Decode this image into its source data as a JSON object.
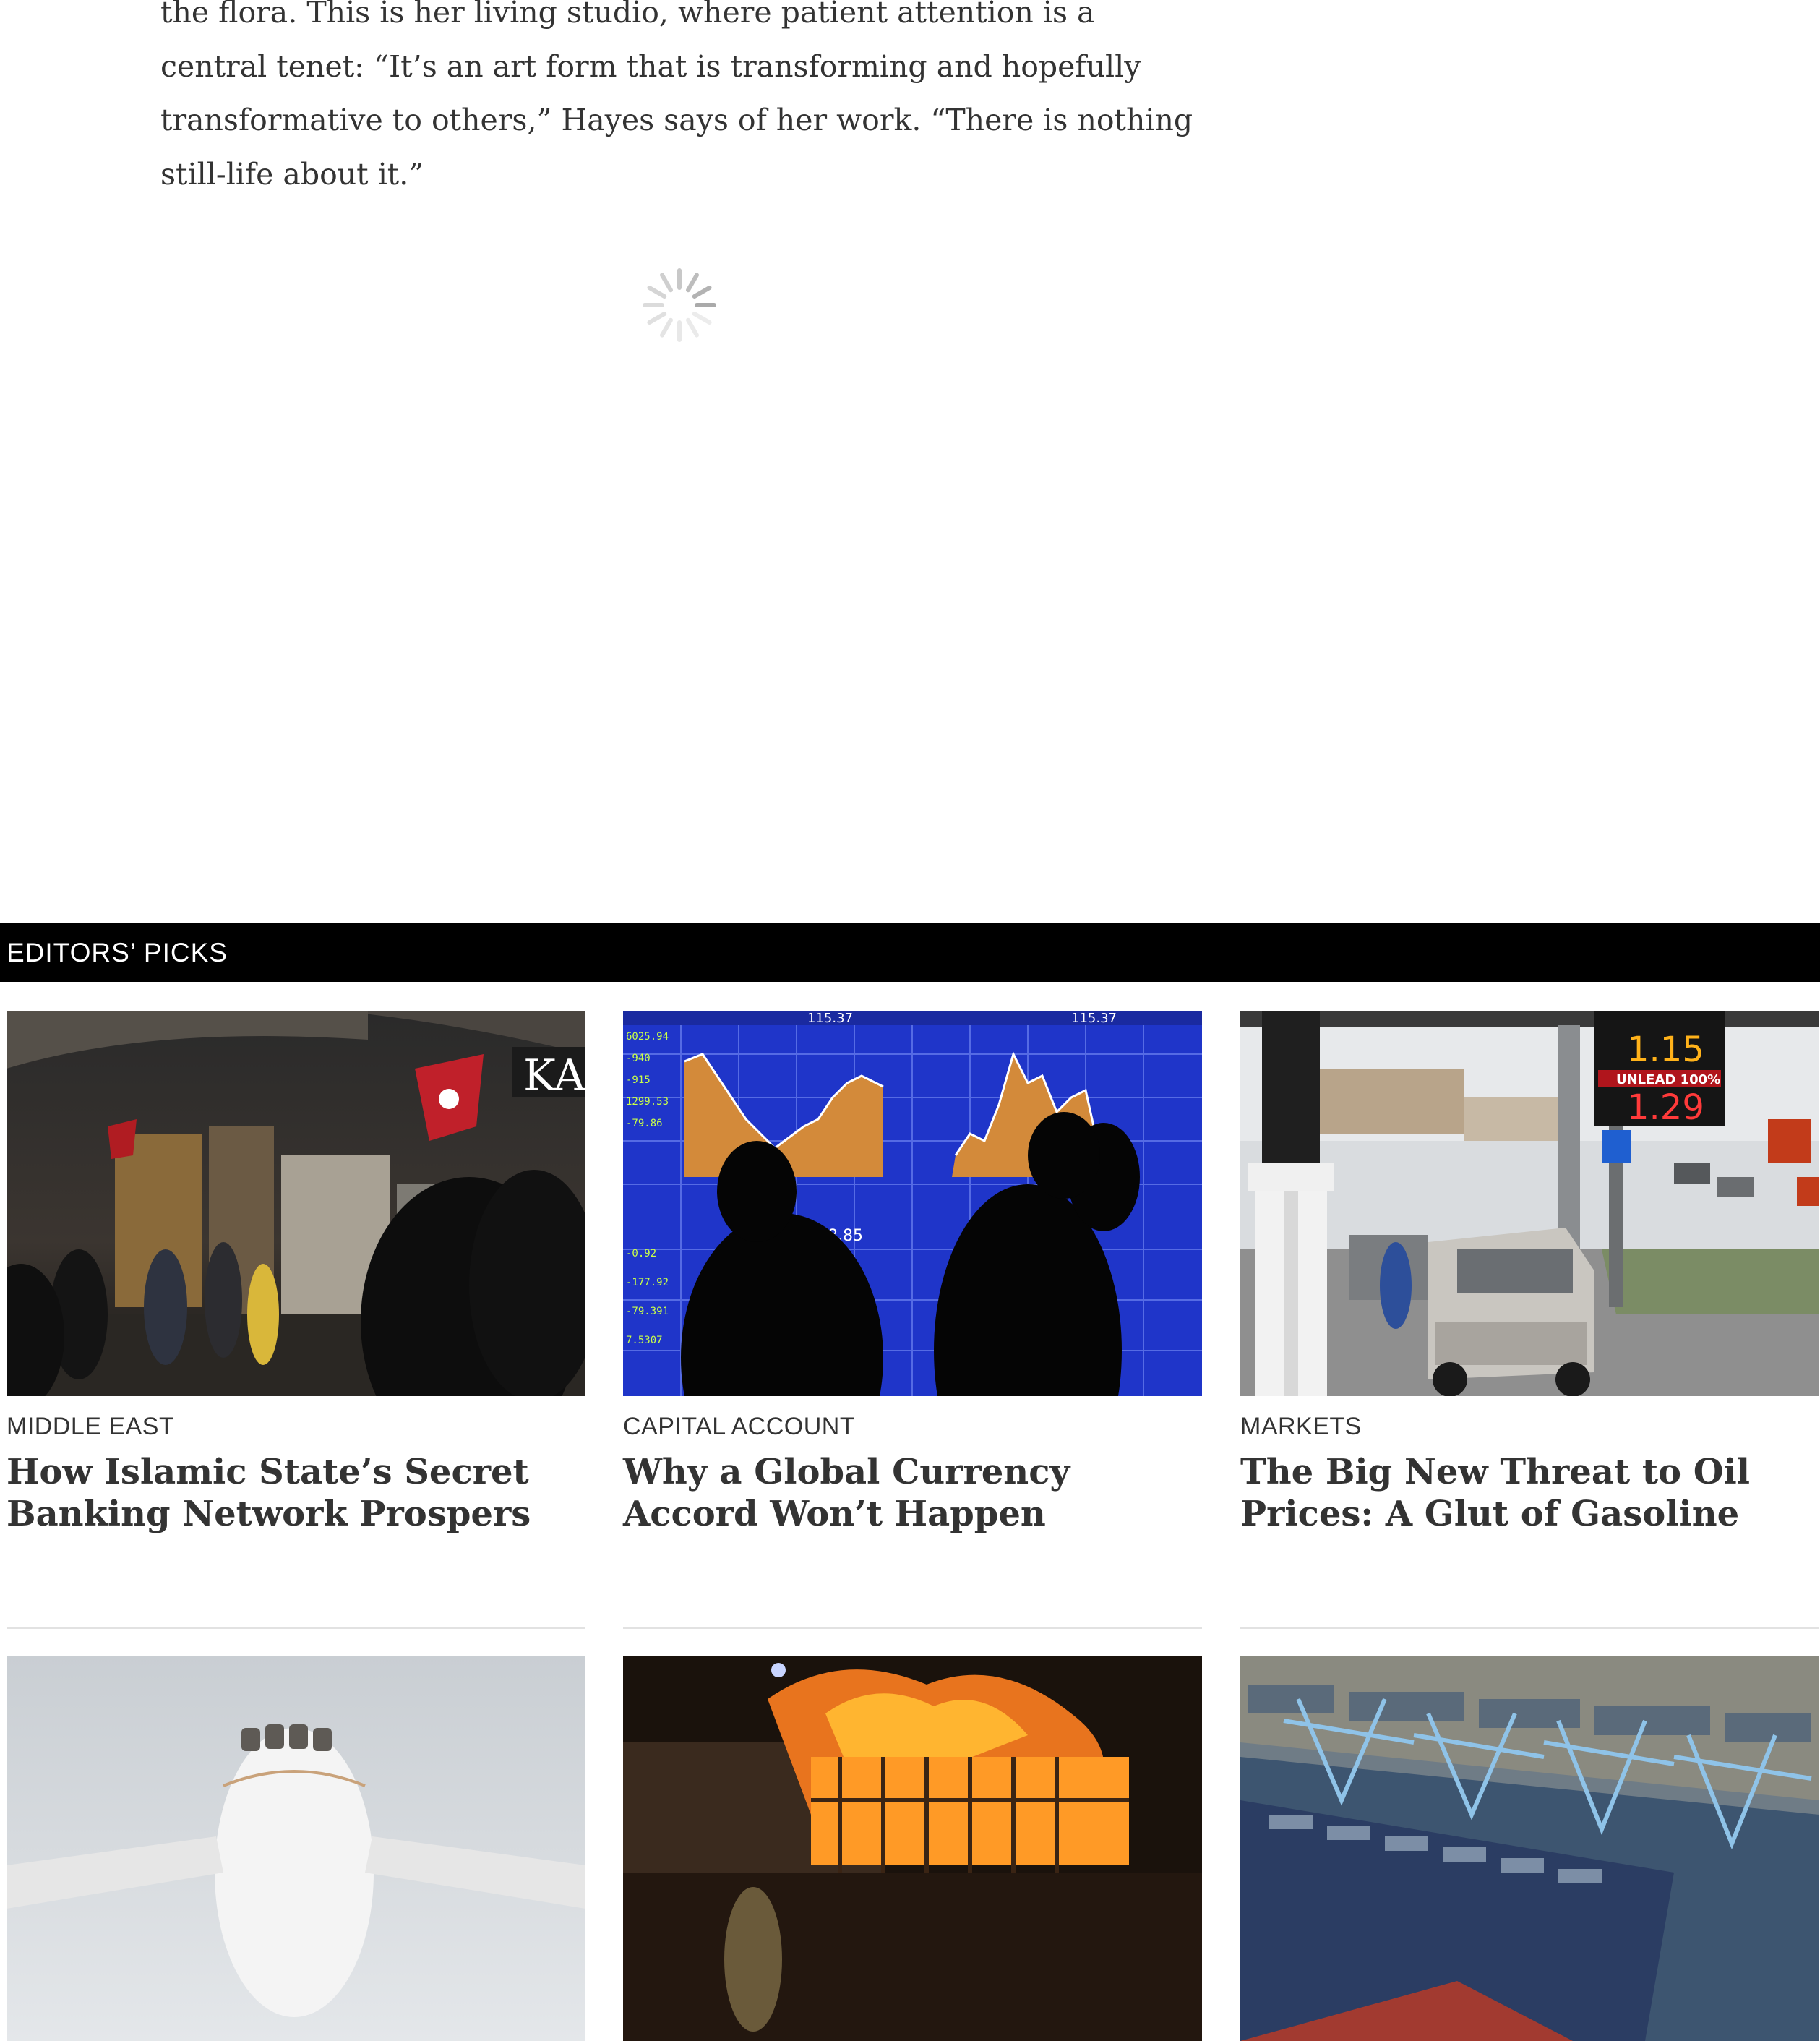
{
  "article": {
    "lines": [
      "the flora. This is her living studio, where patient attention is a",
      "central tenet: “It’s an art form that is transforming and hopefully",
      "transformative to others,” Hayes says of her work. “There is nothing",
      "still-life about it.”"
    ]
  },
  "editors_picks": {
    "title": "EDITORS’ PICKS",
    "cards": [
      {
        "kicker": "MIDDLE EAST",
        "headline": "How Islamic State’s Secret Banking Network Prospers",
        "image": "bazaar-photo"
      },
      {
        "kicker": "CAPITAL ACCOUNT",
        "headline": "Why a Global Currency Accord Won’t Happen",
        "image": "stock-board-photo"
      },
      {
        "kicker": "MARKETS",
        "headline": "The Big New Threat to Oil Prices: A Glut of Gasoline",
        "image": "gas-station-photo"
      },
      {
        "image": "airplane-photo"
      },
      {
        "image": "fire-photo"
      },
      {
        "image": "container-port-photo"
      }
    ],
    "photo_text": {
      "bazaar_sign": "KAS",
      "gas_price_top": "1.15",
      "gas_unlead": "UNLEAD 100%",
      "gas_price_bottom": "1.29",
      "stock_top_left": "115.37",
      "stock_top_right": "115.37",
      "stock_mid": "128.85"
    }
  },
  "colors": {
    "section_bar": "#000000",
    "text": "#333333",
    "divider": "#e2e2e2"
  }
}
